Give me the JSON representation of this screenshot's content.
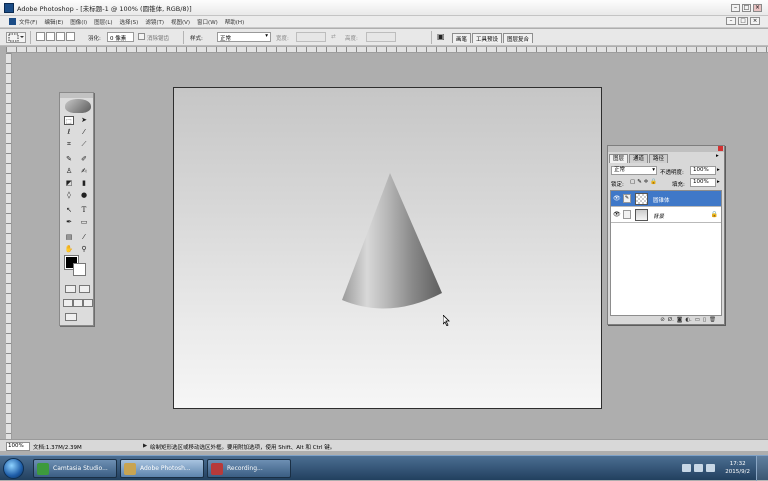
{
  "window": {
    "title": "Adobe Photoshop - [未标题-1 @ 100% (圆锥体, RGB/8)]",
    "min": "–",
    "max": "□",
    "close": "×"
  },
  "menu": {
    "items": [
      "文件(F)",
      "编辑(E)",
      "图像(I)",
      "图层(L)",
      "选择(S)",
      "滤镜(T)",
      "视图(V)",
      "窗口(W)",
      "帮助(H)"
    ]
  },
  "options": {
    "feather_label": "羽化:",
    "feather_value": "0 像素",
    "antialias_label": "消除锯齿",
    "style_label": "样式:",
    "style_value": "正常",
    "width_label": "宽度:",
    "height_label": "高度:",
    "wells": [
      "画笔",
      "工具预设",
      "图层复合"
    ]
  },
  "layers_panel": {
    "tabs": [
      "图层",
      "通道",
      "路径"
    ],
    "blend_mode": "正常",
    "opacity_label": "不透明度:",
    "opacity_value": "100%",
    "lock_label": "锁定:",
    "fill_label": "填充:",
    "fill_value": "100%",
    "layers": [
      {
        "name": "圆锥体",
        "selected": true
      },
      {
        "name": "背景",
        "selected": false,
        "locked": true
      }
    ]
  },
  "status": {
    "zoom": "100%",
    "doc": "文档:1.37M/2.39M",
    "hint": "绘制矩形选区或移动选区外框。要用附加选项，使用 Shift、Alt 和 Ctrl 键。"
  },
  "taskbar": {
    "items": [
      "Camtasia Studio...",
      "Adobe Photosh...",
      "Recording..."
    ],
    "time": "17:32",
    "date": "2015/9/2"
  },
  "colors": {
    "foreground": "#000000",
    "background": "#ffffff",
    "selection": "#3f78c8",
    "taskbar": "#2b4a6b"
  }
}
